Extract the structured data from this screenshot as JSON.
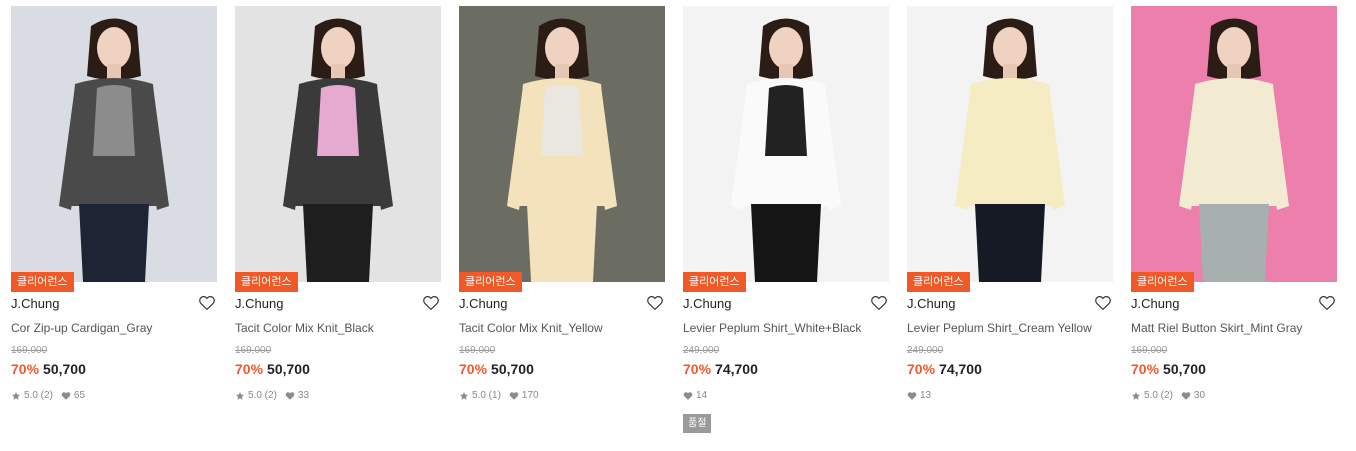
{
  "products": [
    {
      "badge": "클리어런스",
      "brand": "J.Chung",
      "name": "Cor Zip-up Cardigan_Gray",
      "original_price": "169,000",
      "discount": "70%",
      "price": "50,700",
      "rating": "5.0 (2)",
      "likes": "65",
      "sold_out": "",
      "bg_color": "#d9dde3",
      "top_color": "#4a4a4a",
      "inner_color": "#8c8c8c",
      "bottom_color": "#1d2433"
    },
    {
      "badge": "클리어런스",
      "brand": "J.Chung",
      "name": "Tacit Color Mix Knit_Black",
      "original_price": "169,000",
      "discount": "70%",
      "price": "50,700",
      "rating": "5.0 (2)",
      "likes": "33",
      "sold_out": "",
      "bg_color": "#e3e3e3",
      "top_color": "#3a3a3a",
      "inner_color": "#e6a9cf",
      "bottom_color": "#1e1e1e"
    },
    {
      "badge": "클리어런스",
      "brand": "J.Chung",
      "name": "Tacit Color Mix Knit_Yellow",
      "original_price": "169,000",
      "discount": "70%",
      "price": "50,700",
      "rating": "5.0 (1)",
      "likes": "170",
      "sold_out": "",
      "bg_color": "#6b6d63",
      "top_color": "#f4e2bd",
      "inner_color": "#e9e7e0",
      "bottom_color": "#f4e2bd"
    },
    {
      "badge": "클리어런스",
      "brand": "J.Chung",
      "name": "Levier Peplum Shirt_White+Black",
      "original_price": "249,000",
      "discount": "70%",
      "price": "74,700",
      "rating": "",
      "likes": "14",
      "sold_out": "품절",
      "bg_color": "#f3f3f3",
      "top_color": "#fafafa",
      "inner_color": "#222222",
      "bottom_color": "#151515"
    },
    {
      "badge": "클리어런스",
      "brand": "J.Chung",
      "name": "Levier Peplum Shirt_Cream Yellow",
      "original_price": "249,000",
      "discount": "70%",
      "price": "74,700",
      "rating": "",
      "likes": "13",
      "sold_out": "",
      "bg_color": "#f3f3f3",
      "top_color": "#f6ecc4",
      "inner_color": "#f6ecc4",
      "bottom_color": "#151a24"
    },
    {
      "badge": "클리어런스",
      "brand": "J.Chung",
      "name": "Matt Riel Button Skirt_Mint Gray",
      "original_price": "169,000",
      "discount": "70%",
      "price": "50,700",
      "rating": "5.0 (2)",
      "likes": "30",
      "sold_out": "",
      "bg_color": "#ec7fac",
      "top_color": "#f3ead2",
      "inner_color": "#f3ead2",
      "bottom_color": "#a7b0ae"
    }
  ]
}
